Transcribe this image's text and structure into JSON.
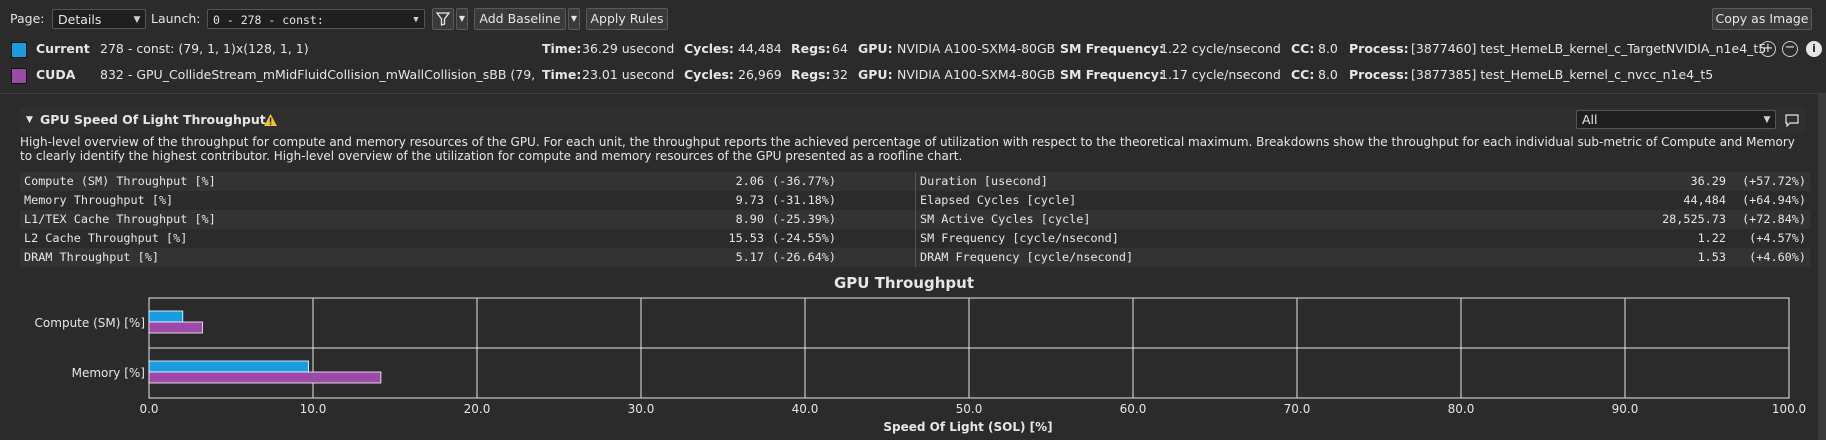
{
  "toolbar": {
    "page_label": "Page:",
    "page_value": "Details",
    "launch_label": "Launch:",
    "launch_value": "0 -   278 - const:",
    "add_baseline": "Add Baseline",
    "apply_rules": "Apply Rules",
    "copy_as_image": "Copy as Image"
  },
  "results": [
    {
      "color": "#1a9de0",
      "name": "Current",
      "kernel": "278 - const: (79, 1, 1)x(128, 1, 1)",
      "time_label": "Time:",
      "time": "36.29 usecond",
      "cycles_label": "Cycles:",
      "cycles": "44,484",
      "regs_label": "Regs:",
      "regs": "64",
      "gpu_label": "GPU:",
      "gpu": "NVIDIA A100-SXM4-80GB",
      "smfreq_label": "SM Frequency:",
      "smfreq": "1.22 cycle/nsecond",
      "cc_label": "CC:",
      "cc": "8.0",
      "process_label": "Process:",
      "process": "[3877460] test_HemeLB_kernel_c_TargetNVIDIA_n1e4_t5"
    },
    {
      "color": "#9b4aa8",
      "name": "CUDA",
      "kernel": "832 - GPU_CollideStream_mMidFluidCollision_mWallCollision_sBB (79, ...",
      "time_label": "Time:",
      "time": "23.01 usecond",
      "cycles_label": "Cycles:",
      "cycles": "26,969",
      "regs_label": "Regs:",
      "regs": "32",
      "gpu_label": "GPU:",
      "gpu": "NVIDIA A100-SXM4-80GB",
      "smfreq_label": "SM Frequency:",
      "smfreq": "1.17 cycle/nsecond",
      "cc_label": "CC:",
      "cc": "8.0",
      "process_label": "Process:",
      "process": "[3877385] test_HemeLB_kernel_c_nvcc_n1e4_t5"
    }
  ],
  "section": {
    "title": "GPU Speed Of Light Throughput",
    "filter_value": "All",
    "description": "High-level overview of the throughput for compute and memory resources of the GPU. For each unit, the throughput reports the achieved percentage of utilization with respect to the theoretical maximum. Breakdowns show the throughput for each individual sub-metric of Compute and Memory to clearly identify the highest contributor. High-level overview of the utilization for compute and memory resources of the GPU presented as a roofline chart."
  },
  "metrics_left": [
    {
      "name": "Compute (SM) Throughput [%]",
      "value": "2.06",
      "diff": "(-36.77%)"
    },
    {
      "name": "Memory Throughput [%]",
      "value": "9.73",
      "diff": "(-31.18%)"
    },
    {
      "name": "L1/TEX Cache Throughput [%]",
      "value": "8.90",
      "diff": "(-25.39%)"
    },
    {
      "name": "L2 Cache Throughput [%]",
      "value": "15.53",
      "diff": "(-24.55%)"
    },
    {
      "name": "DRAM Throughput [%]",
      "value": "5.17",
      "diff": "(-26.64%)"
    }
  ],
  "metrics_right": [
    {
      "name": "Duration [usecond]",
      "value": "36.29",
      "diff": "(+57.72%)"
    },
    {
      "name": "Elapsed Cycles [cycle]",
      "value": "44,484",
      "diff": "(+64.94%)"
    },
    {
      "name": "SM Active Cycles [cycle]",
      "value": "28,525.73",
      "diff": "(+72.84%)"
    },
    {
      "name": "SM Frequency [cycle/nsecond]",
      "value": "1.22",
      "diff": "(+4.57%)"
    },
    {
      "name": "DRAM Frequency [cycle/nsecond]",
      "value": "1.53",
      "diff": "(+4.60%)"
    }
  ],
  "chart_data": {
    "type": "bar",
    "orientation": "horizontal",
    "title": "GPU Throughput",
    "xlabel": "Speed Of Light (SOL) [%]",
    "xlim": [
      0,
      100
    ],
    "xticks": [
      "0.0",
      "10.0",
      "20.0",
      "30.0",
      "40.0",
      "50.0",
      "60.0",
      "70.0",
      "80.0",
      "90.0",
      "100.0"
    ],
    "categories": [
      "Compute (SM) [%]",
      "Memory [%]"
    ],
    "series": [
      {
        "color": "#1a9de0",
        "values": [
          2.06,
          9.73
        ]
      },
      {
        "color": "#9b4aa8",
        "values": [
          3.26,
          14.14
        ]
      }
    ],
    "grid": true
  }
}
